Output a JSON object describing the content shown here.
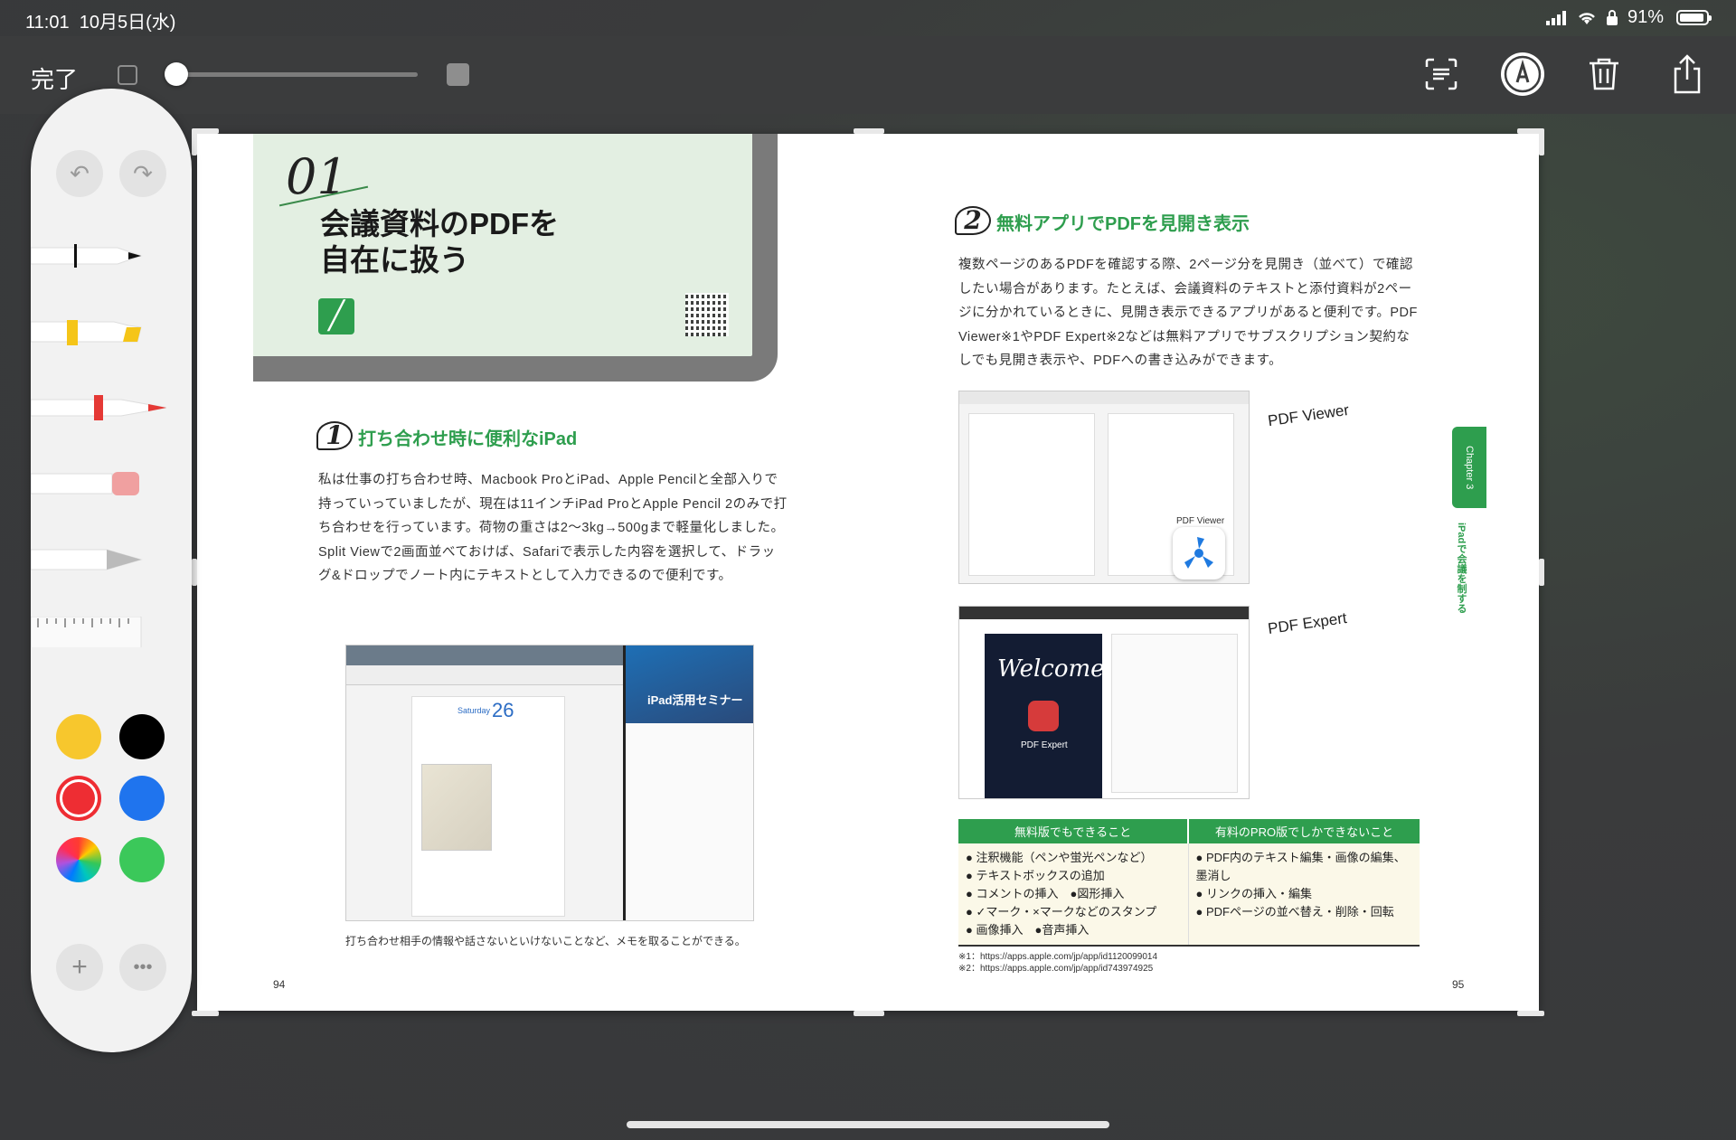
{
  "status_bar": {
    "time": "11:01",
    "date": "10月5日(水)",
    "battery": "91%"
  },
  "toolbar": {
    "done_label": "完了",
    "opacity_slider_value": 0.0,
    "icons": [
      "text-recognition-icon",
      "markup-icon",
      "trash-icon",
      "share-icon"
    ]
  },
  "left_page": {
    "chapter_number": "01",
    "chapter_title_line1": "会議資料のPDFを",
    "chapter_title_line2": "自在に扱う",
    "section1_num": "1",
    "section1_title": "打ち合わせ時に便利なiPad",
    "section1_body1": "私は仕事の打ち合わせ時、Macbook ProとiPad、Apple Pencilと全部入りで持っていっていましたが、現在は11インチiPad ProとApple Pencil 2のみで打ち合わせを行っています。荷物の重さは2〜3kg→500gまで軽量化しました。",
    "section1_body2": "Split Viewで2画面並べておけば、Safariで表示した内容を選択して、ドラッグ&ドロップでノート内にテキストとして入力できるので便利です。",
    "figure_title_right": "iPad活用セミナー",
    "figure_day": "Saturday",
    "figure_date_num": "26",
    "caption": "打ち合わせ相手の情報や話さないといけないことなど、メモを取ることができる。",
    "page_number": "94"
  },
  "right_page": {
    "section2_num": "2",
    "section2_title": "無料アプリでPDFを見開き表示",
    "section2_body": "複数ページのあるPDFを確認する際、2ページ分を見開き（並べて）で確認したい場合があります。たとえば、会議資料のテキストと添付資料が2ページに分かれているときに、見開き表示できるアプリがあると便利です。PDF Viewer※1やPDF Expert※2などは無料アプリでサブスクリプション契約なしでも見開き表示や、PDFへの書き込みができます。",
    "callout1": "PDF Viewer",
    "callout2": "PDF Expert",
    "fig1_label": "PDF Viewer",
    "fig2_welcome": "Welcome",
    "fig2_label": "PDF Expert",
    "table_head_free": "無料版でもできること",
    "table_head_pro": "有料のPRO版でしかできないこと",
    "free_items": [
      "注釈機能（ペンや蛍光ペンなど）",
      "テキストボックスの追加",
      "コメントの挿入　●図形挿入",
      "✓マーク・×マークなどのスタンプ",
      "画像挿入　●音声挿入"
    ],
    "pro_items": [
      "PDF内のテキスト編集・画像の編集、墨消し",
      "リンクの挿入・編集",
      "PDFページの並べ替え・削除・回転"
    ],
    "footnote1": "※1：https://apps.apple.com/jp/app/id1120099014",
    "footnote2": "※2：https://apps.apple.com/jp/app/id743974925",
    "chapter_tab": "Chapter 3",
    "chapter_side": "iPadで会議を制する",
    "page_number": "95"
  },
  "palette": {
    "tools": [
      "pen",
      "highlighter",
      "marker",
      "eraser",
      "pencil",
      "ruler"
    ],
    "colors": {
      "yellow": "#f7c72d",
      "black": "#000000",
      "red": "#ee2d33",
      "blue": "#1f74ee",
      "spectrum": "spectrum",
      "green": "#3bc85a"
    },
    "selected_color": "red"
  }
}
